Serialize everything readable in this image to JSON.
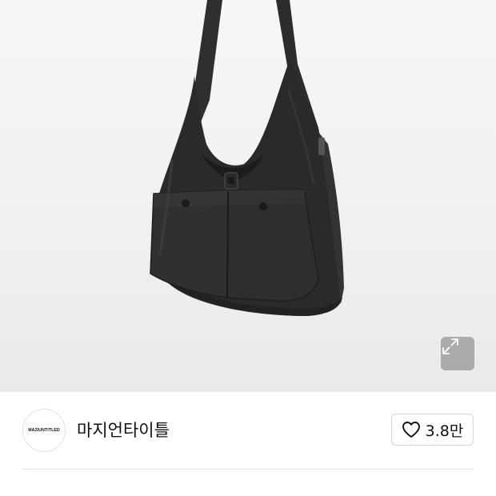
{
  "product": {
    "image_alt": "black nylon shoulder bag with two front pockets"
  },
  "hero": {
    "expand_icon": "expand-arrows-icon"
  },
  "brand": {
    "logo_text": "MAZIUNTITLED",
    "name": "마지언타이틀"
  },
  "like": {
    "icon": "heart-outline-icon",
    "count": "3.8만"
  },
  "colors": {
    "hero_bg": "#f1f1f1",
    "bag": "#2b2b2b",
    "text": "#111111",
    "border": "#d6d6d6"
  }
}
